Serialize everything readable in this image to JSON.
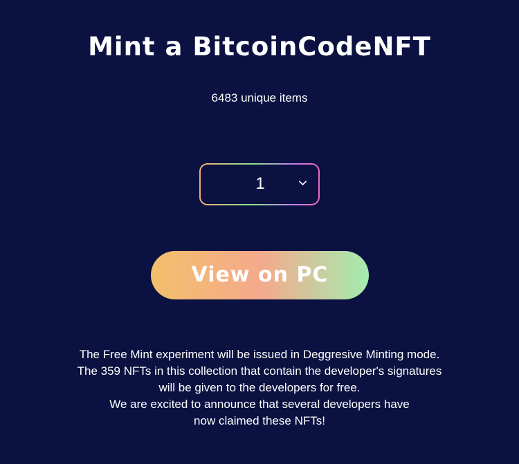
{
  "header": {
    "title": "Mint a BitcoinCodeNFT",
    "subtitle": "6483 unique items"
  },
  "quantity_select": {
    "selected_value": "1"
  },
  "cta": {
    "label": "View on PC",
    "gradient": [
      "#f2c06b",
      "#f5a98c",
      "#a3ecb0"
    ]
  },
  "notice": {
    "lines": [
      "The Free Mint experiment will be issued in Deggresive Minting mode.",
      "The 359 NFTs in this collection that contain the developer's signatures",
      "will be given to the developers for free.",
      "We are excited to announce that several developers have",
      "now claimed these NFTs!"
    ]
  },
  "colors": {
    "background": "#0b1140",
    "text": "#ffffff",
    "select_border_gradient": [
      "#f0b07a",
      "#8be58f",
      "#c77cf0",
      "#f06bbd"
    ]
  },
  "icons": {
    "select_arrow": "chevron-down-icon"
  }
}
